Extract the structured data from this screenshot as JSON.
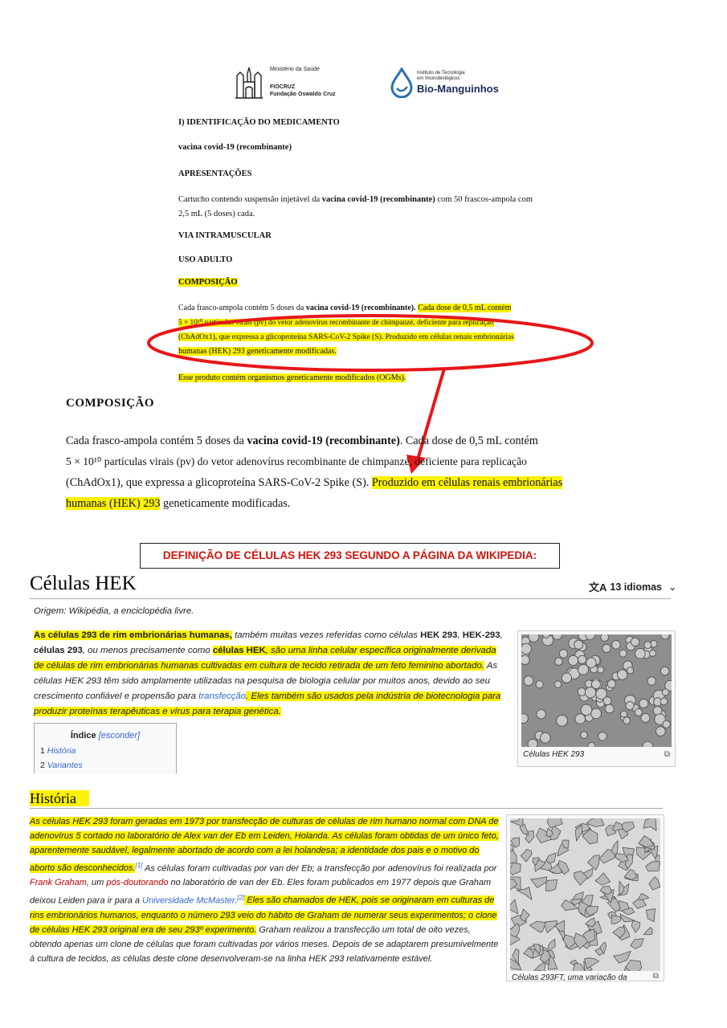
{
  "header": {
    "ministry": "Ministério da Saúde",
    "fiocruz": "FIOCRUZ",
    "fiocruz_full": "Fundação Oswaldo Cruz",
    "bio_small_1": "Instituto de Tecnologia",
    "bio_small_2": "em Imunobiológicos",
    "bio_name": "Bio-Manguinhos"
  },
  "leaflet": {
    "section1": "I) IDENTIFICAÇÃO DO MEDICAMENTO",
    "product": "vacina covid-19 (recombinante)",
    "apresentacoes": "APRESENTAÇÕES",
    "apres_text_1": "Cartucho contendo suspensão injetável da",
    "apres_bold": "vacina covid-19 (recombinante)",
    "apres_text_2": "com 50 frascos-ampola com",
    "apres_text_3": "2,5 mL (5 doses) cada.",
    "via": "VIA INTRAMUSCULAR",
    "uso": "USO ADULTO",
    "composicao": "COMPOSIÇÃO",
    "comp_line1_a": "Cada frasco-ampola contém 5 doses da",
    "comp_line1_b": "vacina covid-19 (recombinante).",
    "comp_line1_c": "Cada dose de 0,5 mL contém",
    "comp_line2": "5 × 10¹⁰ partículas virais (pv) do vetor adenovírus recombinante de chimpanzé, deficiente para replicação",
    "comp_line3": "(ChAdOx1), que expressa a glicoproteína SARS-CoV-2 Spike (S). Produzido em células renais embrionárias",
    "comp_line4": "humanas (HEK) 293 geneticamente modificadas.",
    "ogm": "Esse produto contém organismos geneticamente modificados (OGMs)."
  },
  "zoom": {
    "title": "COMPOSIÇÃO",
    "l1a": "Cada frasco-ampola contém 5 doses da",
    "l1b": "vacina covid-19 (recombinante)",
    "l1c": ". Cada dose de 0,5 mL contém",
    "l2": "5 × 10¹⁰ partículas virais (pv) do vetor adenovírus recombinante de chimpanzé, deficiente para replicação",
    "l3a": "(ChAdOx1), que expressa a glicoproteína SARS-CoV-2 Spike (S).",
    "l3b": "Produzido em células renais embrionárias",
    "l4a": "humanas (HEK) 293",
    "l4b": "geneticamente modificadas."
  },
  "banner": "DEFINIÇÃO DE CÉLULAS HEK 293 SEGUNDO A PÁGINA DA WIKIPEDIA:",
  "wiki": {
    "title": "Células HEK",
    "languages": "13 idiomas",
    "origin": "Origem: Wikipédia, a enciclopédia livre.",
    "p1": [
      "As células 293 de rim embrionárias humanas,",
      " também muitas vezes referidas como células ",
      "HEK 293",
      ", ",
      "HEK-293",
      ", ",
      "células 293",
      ", ou menos precisamente como ",
      "células HEK",
      ", são uma linha celular específica originalmente derivada de células de rim embrionárias humanas cultivadas em cultura de tecido retirada de um feto feminino abortado.",
      " As células HEK 293 têm sido amplamente utilizadas na pesquisa de biologia celular por muitos anos, devido ao seu crescimento confiável e propensão para ",
      "transfecção",
      ". Eles também são usados pela indústria de biotecnologia para produzir proteínas terapêuticas e vírus para terapia genética."
    ],
    "toc_title": "Índice",
    "toc_toggle": "[esconder]",
    "toc_items": [
      {
        "num": "1",
        "label": "História"
      },
      {
        "num": "2",
        "label": "Variantes"
      }
    ],
    "image1_caption": "Células HEK 293",
    "history_heading": "História",
    "p2": [
      "As células HEK 293 foram geradas em 1973 por transfecção de culturas de células de rim humano normal com DNA de adenovírus 5 cortado no laboratório de Alex van der Eb em Leiden, Holanda. As células foram obtidas de um único feto, aparentemente saudável, legalmente abortado de acordo com a lei holandesa; a identidade dos pais e o motivo do aborto são desconhecidos.",
      "[1]",
      " As células foram cultivadas por van der Eb; a transfecção por adenovírus foi realizada por ",
      "Frank Graham",
      ", um ",
      "pós-doutorando",
      " no laboratório de van der Eb. Eles foram publicados em 1977 depois que Graham deixou Leiden para ir para a ",
      "Universidade McMaster",
      ".",
      "[2]",
      " Eles são chamados de HEK, pois se originaram em culturas de rins embrionários humanos, enquanto o número 293 veio do hábito de Graham de numerar seus experimentos; o clone de células HEK 293 original era de seu 293º experimento.",
      " Graham realizou a transfecção um total de oito vezes, obtendo apenas um clone de células que foram cultivadas por vários meses. Depois de se adaptarem presumivelmente à cultura de tecidos, as células deste clone desenvolveram-se na linha HEK 293 relativamente estável."
    ],
    "image2_caption": "Células 293FT, uma variação da"
  },
  "colors": {
    "highlight": "#fbf100",
    "annotation_red": "#e8161a",
    "banner_text": "#d0140c",
    "link": "#3366cc"
  }
}
